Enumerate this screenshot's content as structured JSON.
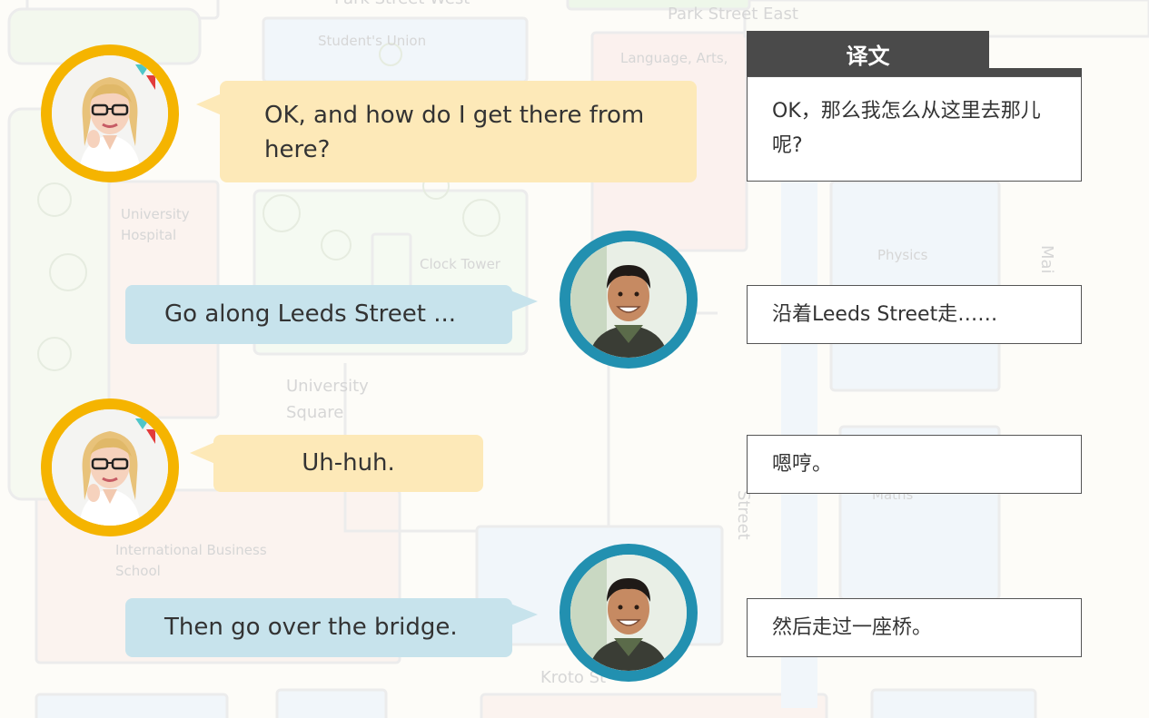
{
  "map": {
    "labels": {
      "park_street_west": "Park Street West",
      "park_street_east": "Park Street East",
      "students_union": "Student's Union",
      "language_arts": "Language, Arts,",
      "university_hospital_1": "University",
      "university_hospital_2": "Hospital",
      "clock_tower": "Clock Tower",
      "physics": "Physics",
      "university_square_1": "University",
      "university_square_2": "Square",
      "maths": "Maths",
      "international_business_1": "International Business",
      "international_business_2": "School",
      "kroto": "Kroto St",
      "street_vertical": "Street",
      "main_vertical": "Mai"
    }
  },
  "dialogue": {
    "line1": "OK, and how do I get there from here?",
    "line2": "Go along Leeds Street ...",
    "line3": "Uh-huh.",
    "line4": "Then go over the bridge."
  },
  "translation": {
    "header": "译文",
    "line1": "OK，那么我怎么从这里去那儿呢?",
    "line2": "沿着Leeds Street走……",
    "line3": "嗯哼。",
    "line4": "然后走过一座桥。"
  },
  "colors": {
    "female_ring": "#f5b400",
    "male_ring": "#2290b0",
    "yellow_bubble": "#fde9b8",
    "blue_bubble": "#c7e3ec",
    "header_bg": "#4a4a4a"
  }
}
